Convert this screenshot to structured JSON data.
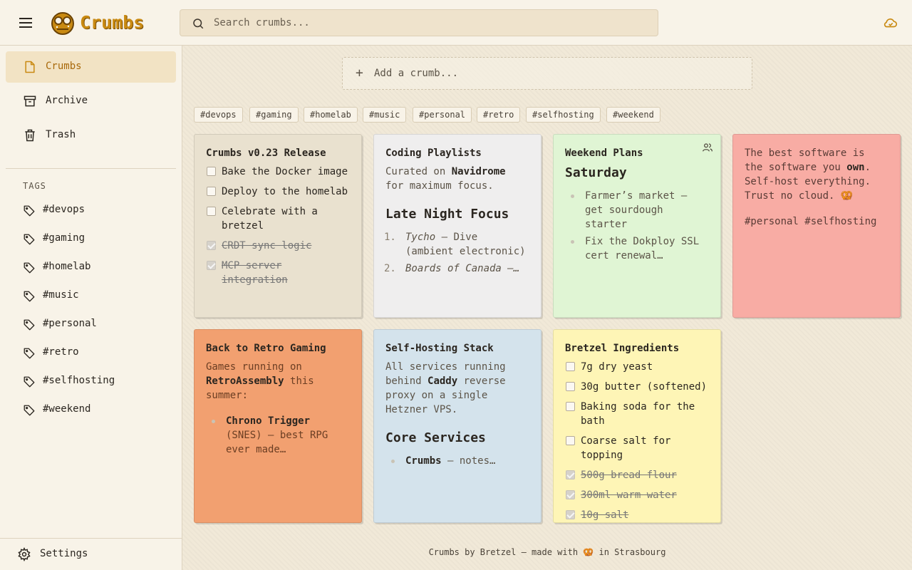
{
  "app": {
    "brand": "Crumbs"
  },
  "search": {
    "placeholder": "Search crumbs..."
  },
  "sidebar": {
    "nav": [
      {
        "label": "Crumbs",
        "icon": "note-icon",
        "active": true
      },
      {
        "label": "Archive",
        "icon": "archive-icon"
      },
      {
        "label": "Trash",
        "icon": "trash-icon"
      }
    ],
    "tags_title": "TAGS",
    "tags": [
      "#devops",
      "#gaming",
      "#homelab",
      "#music",
      "#personal",
      "#retro",
      "#selfhosting",
      "#weekend"
    ],
    "settings_label": "Settings"
  },
  "main": {
    "add_placeholder": "Add a crumb...",
    "add_plus": "+",
    "filter_chips": [
      "#devops",
      "#gaming",
      "#homelab",
      "#music",
      "#personal",
      "#retro",
      "#selfhosting",
      "#weekend"
    ],
    "footer": {
      "prefix": "Crumbs by Bretzel — made with",
      "emoji": "🥨",
      "suffix": "in Strasbourg"
    }
  },
  "cards": {
    "release": {
      "title": "Crumbs v0.23 Release",
      "color": "#e9e1cf",
      "items": [
        {
          "text": "Bake the Docker image",
          "done": false
        },
        {
          "text": "Deploy to the homelab",
          "done": false
        },
        {
          "text": "Celebrate with a bretzel",
          "done": false
        },
        {
          "text": "CRDT sync logic",
          "done": true
        },
        {
          "text": "MCP server integration",
          "done": true
        }
      ]
    },
    "playlists": {
      "title": "Coding Playlists",
      "color": "#efeeee",
      "intro_pre": "Curated on",
      "intro_bold": "Navidrome",
      "intro_post": "for maximum focus.",
      "heading": "Late Night Focus",
      "list": [
        {
          "num": "1.",
          "title": "Tycho",
          "rest": " — Dive (ambient electronic)"
        },
        {
          "num": "2.",
          "title": "Boards of Canada",
          "rest": " —…"
        }
      ]
    },
    "weekend": {
      "title": "Weekend Plans",
      "color": "#e0f5d4",
      "heading": "Saturday",
      "items": [
        "Farmer’s market — get sourdough starter",
        "Fix the Dokploy SSL cert renewal…"
      ]
    },
    "quote": {
      "color": "#f8aca4",
      "text_pre": "The best software is the software you",
      "text_bold": "own",
      "text_post": ". Self-host everything. Trust no cloud. 🥨",
      "tags": "#personal #selfhosting"
    },
    "retro": {
      "title": "Back to Retro Gaming",
      "color": "#f2a070",
      "intro_pre": "Games running on",
      "intro_bold": "RetroAssembly",
      "intro_post": "this summer:",
      "item_bold": "Chrono Trigger",
      "item_rest": "(SNES) — best RPG ever made…"
    },
    "stack": {
      "title": "Self-Hosting Stack",
      "color": "#d4e3ec",
      "intro_pre": "All services running behind",
      "intro_bold": "Caddy",
      "intro_post": "reverse proxy on a single Hetzner VPS.",
      "heading": "Core Services",
      "item_bold": "Crumbs",
      "item_rest": " — notes…"
    },
    "ingredients": {
      "title": "Bretzel Ingredients",
      "color": "#fef5b6",
      "items": [
        {
          "text": "7g dry yeast",
          "done": false
        },
        {
          "text": "30g butter (softened)",
          "done": false
        },
        {
          "text": "Baking soda for the bath",
          "done": false
        },
        {
          "text": "Coarse salt for topping",
          "done": false
        },
        {
          "text": "500g bread flour",
          "done": true
        },
        {
          "text": "300ml warm water",
          "done": true
        },
        {
          "text": "10g salt",
          "done": true
        }
      ]
    }
  },
  "colors": {
    "accent": "#c98a12",
    "active_bg": "#f2e3c4"
  }
}
